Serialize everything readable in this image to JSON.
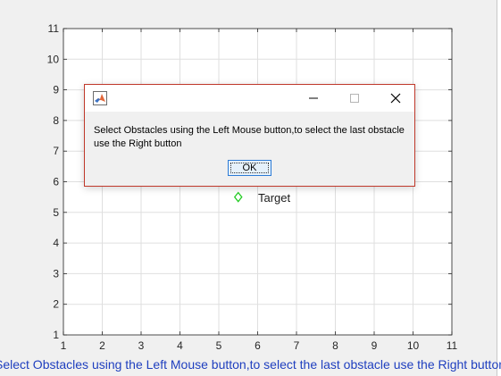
{
  "figure": {
    "status_text": "Select Obstacles using the Left Mouse button,to select the last obstacle use the Right button"
  },
  "plot": {
    "x_ticks": [
      "1",
      "2",
      "3",
      "4",
      "5",
      "6",
      "7",
      "8",
      "9",
      "10",
      "11"
    ],
    "y_ticks": [
      "1",
      "2",
      "3",
      "4",
      "5",
      "6",
      "7",
      "8",
      "9",
      "10",
      "11"
    ],
    "xlim": [
      1,
      11
    ],
    "ylim": [
      1,
      11
    ],
    "grid": true,
    "target": {
      "x": 5.5,
      "y": 5.5,
      "marker": "diamond",
      "color": "#22cc22",
      "label": "Target"
    }
  },
  "dialog": {
    "app_icon": "matlab-logo-icon",
    "message": "Select Obstacles using the Left Mouse button,to select the last obstacle use the Right button",
    "ok_label": "OK",
    "border_color": "#c0392b",
    "minimize_icon": "minimize-icon",
    "maximize_icon": "maximize-icon",
    "close_icon": "close-icon"
  }
}
